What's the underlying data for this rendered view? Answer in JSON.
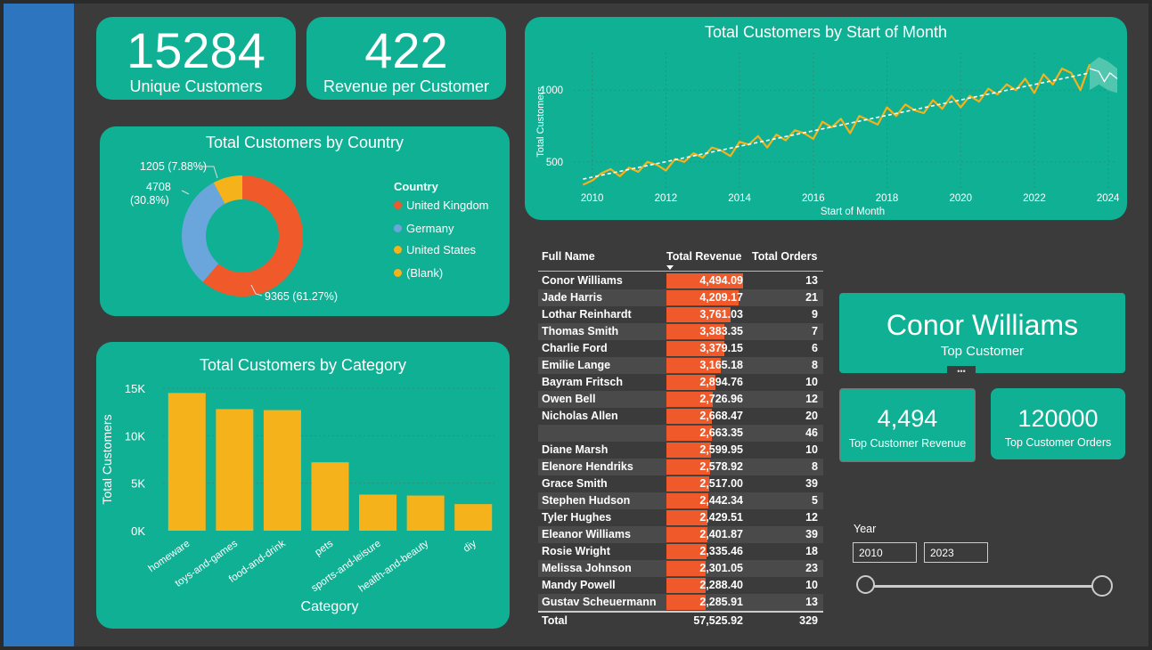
{
  "kpis": {
    "unique_customers": {
      "value": "15284",
      "label": "Unique Customers"
    },
    "revenue_per_customer": {
      "value": "422",
      "label": "Revenue per Customer"
    }
  },
  "country_chart": {
    "title": "Total Customers by Country",
    "legend_title": "Country",
    "legend": [
      {
        "label": "United Kingdom",
        "color": "#f05a2a"
      },
      {
        "label": "Germany",
        "color": "#6aa6dc"
      },
      {
        "label": "United States",
        "color": "#f5b21a"
      },
      {
        "label": "(Blank)",
        "color": "#f5b21a"
      }
    ],
    "labels": {
      "uk": "9365 (61.27%)",
      "de_value": "4708",
      "de_pct": "(30.8%)",
      "us": "1205 (7.88%)"
    }
  },
  "category_chart": {
    "title": "Total Customers by Category",
    "ylabel": "Total Customers",
    "xlabel": "Category",
    "yticks": [
      "0K",
      "5K",
      "10K",
      "15K"
    ]
  },
  "month_chart": {
    "title": "Total Customers by Start of Month",
    "ylabel": "Total Customers",
    "xlabel": "Start of Month",
    "yticks": [
      "500",
      "1000"
    ],
    "xticks": [
      "2010",
      "2012",
      "2014",
      "2016",
      "2018",
      "2020",
      "2022",
      "2024"
    ]
  },
  "table": {
    "headers": {
      "name": "Full Name",
      "revenue": "Total Revenue",
      "orders": "Total Orders"
    },
    "rows": [
      {
        "name": "Conor Williams",
        "revenue": "4,494.09",
        "orders": "13"
      },
      {
        "name": "Jade Harris",
        "revenue": "4,209.17",
        "orders": "21"
      },
      {
        "name": "Lothar Reinhardt",
        "revenue": "3,761.03",
        "orders": "9"
      },
      {
        "name": "Thomas Smith",
        "revenue": "3,383.35",
        "orders": "7"
      },
      {
        "name": "Charlie Ford",
        "revenue": "3,379.15",
        "orders": "6"
      },
      {
        "name": "Emilie Lange",
        "revenue": "3,165.18",
        "orders": "8"
      },
      {
        "name": "Bayram Fritsch",
        "revenue": "2,894.76",
        "orders": "10"
      },
      {
        "name": "Owen Bell",
        "revenue": "2,726.96",
        "orders": "12"
      },
      {
        "name": "Nicholas Allen",
        "revenue": "2,668.47",
        "orders": "20"
      },
      {
        "name": "",
        "revenue": "2,663.35",
        "orders": "46"
      },
      {
        "name": "Diane Marsh",
        "revenue": "2,599.95",
        "orders": "10"
      },
      {
        "name": "Elenore Hendriks",
        "revenue": "2,578.92",
        "orders": "8"
      },
      {
        "name": "Grace Smith",
        "revenue": "2,517.00",
        "orders": "39"
      },
      {
        "name": "Stephen Hudson",
        "revenue": "2,442.34",
        "orders": "5"
      },
      {
        "name": "Tyler Hughes",
        "revenue": "2,429.51",
        "orders": "12"
      },
      {
        "name": "Eleanor Williams",
        "revenue": "2,401.87",
        "orders": "39"
      },
      {
        "name": "Rosie Wright",
        "revenue": "2,335.46",
        "orders": "18"
      },
      {
        "name": "Melissa Johnson",
        "revenue": "2,301.05",
        "orders": "23"
      },
      {
        "name": "Mandy Powell",
        "revenue": "2,288.40",
        "orders": "10"
      },
      {
        "name": "Gustav Scheuermann",
        "revenue": "2,285.91",
        "orders": "13"
      }
    ],
    "total": {
      "label": "Total",
      "revenue": "57,525.92",
      "orders": "329"
    }
  },
  "top_customer": {
    "name": "Conor Williams",
    "label": "Top Customer",
    "more": "•••"
  },
  "top_revenue": {
    "value": "4,494",
    "label": "Top Customer Revenue"
  },
  "top_orders": {
    "value": "120000",
    "label": "Top Customer Orders"
  },
  "slicer": {
    "title": "Year",
    "from": "2010",
    "to": "2023"
  },
  "colors": {
    "teal": "#10b094",
    "sidebar": "#2e75c0",
    "background": "#3b3b3b",
    "orange": "#f05a2a",
    "blue": "#6aa6dc",
    "yellow": "#f5b21a"
  },
  "chart_data": [
    {
      "type": "pie",
      "title": "Total Customers by Country",
      "categories": [
        "United Kingdom",
        "Germany",
        "United States"
      ],
      "values": [
        9365,
        4708,
        1205
      ],
      "legend": "right"
    },
    {
      "type": "bar",
      "title": "Total Customers by Category",
      "categories": [
        "homeware",
        "toys-and-games",
        "food-and-drink",
        "pets",
        "sports-and-leisure",
        "health-and-beauty",
        "diy"
      ],
      "values": [
        14500,
        12800,
        12700,
        7200,
        3800,
        3700,
        2800
      ],
      "xlabel": "Category",
      "ylabel": "Total Customers",
      "ylim": [
        0,
        15000
      ],
      "grid": true
    },
    {
      "type": "line",
      "title": "Total Customers by Start of Month",
      "xlabel": "Start of Month",
      "ylabel": "Total Customers",
      "x": [
        2009.75,
        2010.0,
        2010.25,
        2010.5,
        2010.75,
        2011.0,
        2011.25,
        2011.5,
        2011.75,
        2012.0,
        2012.25,
        2012.5,
        2012.75,
        2013.0,
        2013.25,
        2013.5,
        2013.75,
        2014.0,
        2014.25,
        2014.5,
        2014.75,
        2015.0,
        2015.25,
        2015.5,
        2015.75,
        2016.0,
        2016.25,
        2016.5,
        2016.75,
        2017.0,
        2017.25,
        2017.5,
        2017.75,
        2018.0,
        2018.25,
        2018.5,
        2018.75,
        2019.0,
        2019.25,
        2019.5,
        2019.75,
        2020.0,
        2020.25,
        2020.5,
        2020.75,
        2021.0,
        2021.25,
        2021.5,
        2021.75,
        2022.0,
        2022.25,
        2022.5,
        2022.75,
        2023.0,
        2023.25,
        2023.5
      ],
      "series": [
        {
          "values": [
            340,
            370,
            420,
            450,
            400,
            460,
            430,
            500,
            480,
            440,
            520,
            500,
            560,
            530,
            600,
            580,
            540,
            640,
            620,
            680,
            600,
            690,
            650,
            720,
            700,
            660,
            780,
            740,
            800,
            700,
            820,
            790,
            760,
            880,
            820,
            900,
            860,
            840,
            930,
            870,
            960,
            880,
            960,
            920,
            1010,
            970,
            1040,
            1000,
            1080,
            980,
            1110,
            1040,
            1150,
            1120,
            1000,
            1180
          ]
        }
      ],
      "trendline": true,
      "ylim": [
        300,
        1200
      ],
      "xlim": [
        2009.5,
        2024.25
      ],
      "grid": true
    }
  ]
}
